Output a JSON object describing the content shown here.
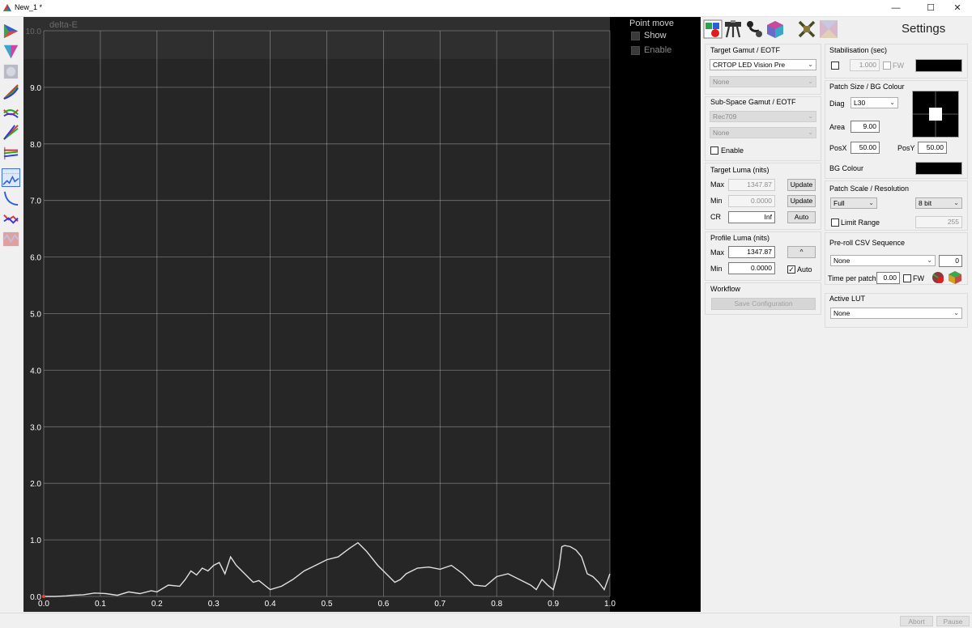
{
  "window": {
    "title": "New_1 *",
    "minimize_glyph": "—",
    "maximize_glyph": "☐",
    "close_glyph": "✕"
  },
  "left_toolbar": {
    "icons": [
      "gamut-triangle-icon",
      "gamut-3d-icon",
      "grey-patch-icon",
      "rgb-curves-icon",
      "rgb-separation-icon",
      "rgb-gamma-icon",
      "rgb-balance-icon",
      "delta-e-graph-icon",
      "luma-curve-icon",
      "rgb-error-icon",
      "colour-checker-icon"
    ],
    "selected": "delta-e-graph-icon"
  },
  "chart_data": {
    "type": "line",
    "title": "delta-E",
    "xlabel": "",
    "ylabel": "",
    "xlim": [
      0.0,
      1.0
    ],
    "ylim": [
      0.0,
      10.0
    ],
    "x_ticks": [
      "0.0",
      "0.1",
      "0.2",
      "0.3",
      "0.4",
      "0.5",
      "0.6",
      "0.7",
      "0.8",
      "0.9",
      "1.0"
    ],
    "y_ticks": [
      "0.0",
      "1.0",
      "2.0",
      "3.0",
      "4.0",
      "5.0",
      "6.0",
      "7.0",
      "8.0",
      "9.0",
      "10.0"
    ],
    "grid": true,
    "line_color": "#e0e0e0",
    "x": [
      0.0,
      0.02,
      0.04,
      0.05,
      0.07,
      0.09,
      0.11,
      0.13,
      0.15,
      0.17,
      0.19,
      0.2,
      0.22,
      0.24,
      0.25,
      0.26,
      0.27,
      0.28,
      0.29,
      0.3,
      0.31,
      0.32,
      0.33,
      0.34,
      0.35,
      0.36,
      0.37,
      0.38,
      0.39,
      0.4,
      0.42,
      0.44,
      0.46,
      0.48,
      0.5,
      0.52,
      0.54,
      0.555,
      0.57,
      0.59,
      0.61,
      0.62,
      0.63,
      0.64,
      0.66,
      0.68,
      0.7,
      0.72,
      0.74,
      0.76,
      0.78,
      0.8,
      0.82,
      0.84,
      0.86,
      0.87,
      0.88,
      0.89,
      0.9,
      0.91,
      0.915,
      0.92,
      0.93,
      0.94,
      0.95,
      0.96,
      0.97,
      0.98,
      0.99,
      1.0
    ],
    "values": [
      0.0,
      0.0,
      0.01,
      0.02,
      0.03,
      0.06,
      0.05,
      0.02,
      0.08,
      0.05,
      0.1,
      0.08,
      0.2,
      0.18,
      0.3,
      0.45,
      0.38,
      0.5,
      0.45,
      0.55,
      0.6,
      0.4,
      0.7,
      0.55,
      0.45,
      0.35,
      0.25,
      0.28,
      0.2,
      0.12,
      0.18,
      0.3,
      0.45,
      0.55,
      0.65,
      0.7,
      0.85,
      0.95,
      0.8,
      0.55,
      0.35,
      0.25,
      0.3,
      0.4,
      0.5,
      0.52,
      0.48,
      0.55,
      0.4,
      0.2,
      0.18,
      0.35,
      0.4,
      0.3,
      0.2,
      0.12,
      0.3,
      0.2,
      0.12,
      0.5,
      0.88,
      0.9,
      0.88,
      0.82,
      0.7,
      0.4,
      0.35,
      0.25,
      0.12,
      0.4
    ],
    "marker_first_point_color": "#ff3b3b"
  },
  "point_move": {
    "title": "Point move",
    "show_label": "Show",
    "enable_label": "Enable"
  },
  "settings": {
    "title": "Settings",
    "tool_icons": [
      "measure-patch-icon",
      "meter-icon",
      "probe-sensor-icon",
      "profile-cube-icon",
      "disconnect-icon",
      "lut-cube-icon"
    ],
    "target_gamut": {
      "title": "Target Gamut / EOTF",
      "gamut_value": "CRTOP LED Vision Pre",
      "eotf_value": "None"
    },
    "sub_space": {
      "title": "Sub-Space  Gamut / EOTF",
      "gamut_value": "Rec709",
      "eotf_value": "None",
      "enable_label": "Enable"
    },
    "target_luma": {
      "title": "Target Luma (nits)",
      "max_label": "Max",
      "max_value": "1347.87",
      "min_label": "Min",
      "min_value": "0.0000",
      "cr_label": "CR",
      "cr_value": "Inf",
      "update_label": "Update",
      "auto_label": "Auto"
    },
    "profile_luma": {
      "title": "Profile Luma (nits)",
      "max_label": "Max",
      "max_value": "1347.87",
      "min_label": "Min",
      "min_value": "0.0000",
      "up_label": "^",
      "auto_label": "Auto",
      "auto_checked": true
    },
    "workflow": {
      "title": "Workflow",
      "save_label": "Save Configuration"
    },
    "stabilisation": {
      "title": "Stabilisation (sec)",
      "value": "1.000",
      "fw_label": "FW"
    },
    "patch_size": {
      "title": "Patch Size / BG Colour",
      "diag_label": "Diag",
      "diag_value": "L30",
      "area_label": "Area",
      "area_value": "9.00",
      "posx_label": "PosX",
      "posx_value": "50.00",
      "posy_label": "PosY",
      "posy_value": "50.00",
      "bg_label": "BG Colour",
      "bg_color": "#000000",
      "patch_color": "#ffffff"
    },
    "patch_scale": {
      "title": "Patch Scale / Resolution",
      "scale_value": "Full",
      "bit_value": "8 bit",
      "limit_label": "Limit Range",
      "limit_value": "255"
    },
    "preroll": {
      "title": "Pre-roll CSV Sequence",
      "sequence_value": "None",
      "count_value": "0",
      "time_label": "Time per patch",
      "time_value": "0.00",
      "fw_label": "FW"
    },
    "active_lut": {
      "title": "Active LUT",
      "value": "None"
    }
  },
  "status": {
    "abort_label": "Abort",
    "pause_label": "Pause"
  },
  "colors": {
    "graph_bg": "#262626",
    "grid": "#b4b4b4",
    "accent_selected": "#3b6fd8"
  }
}
